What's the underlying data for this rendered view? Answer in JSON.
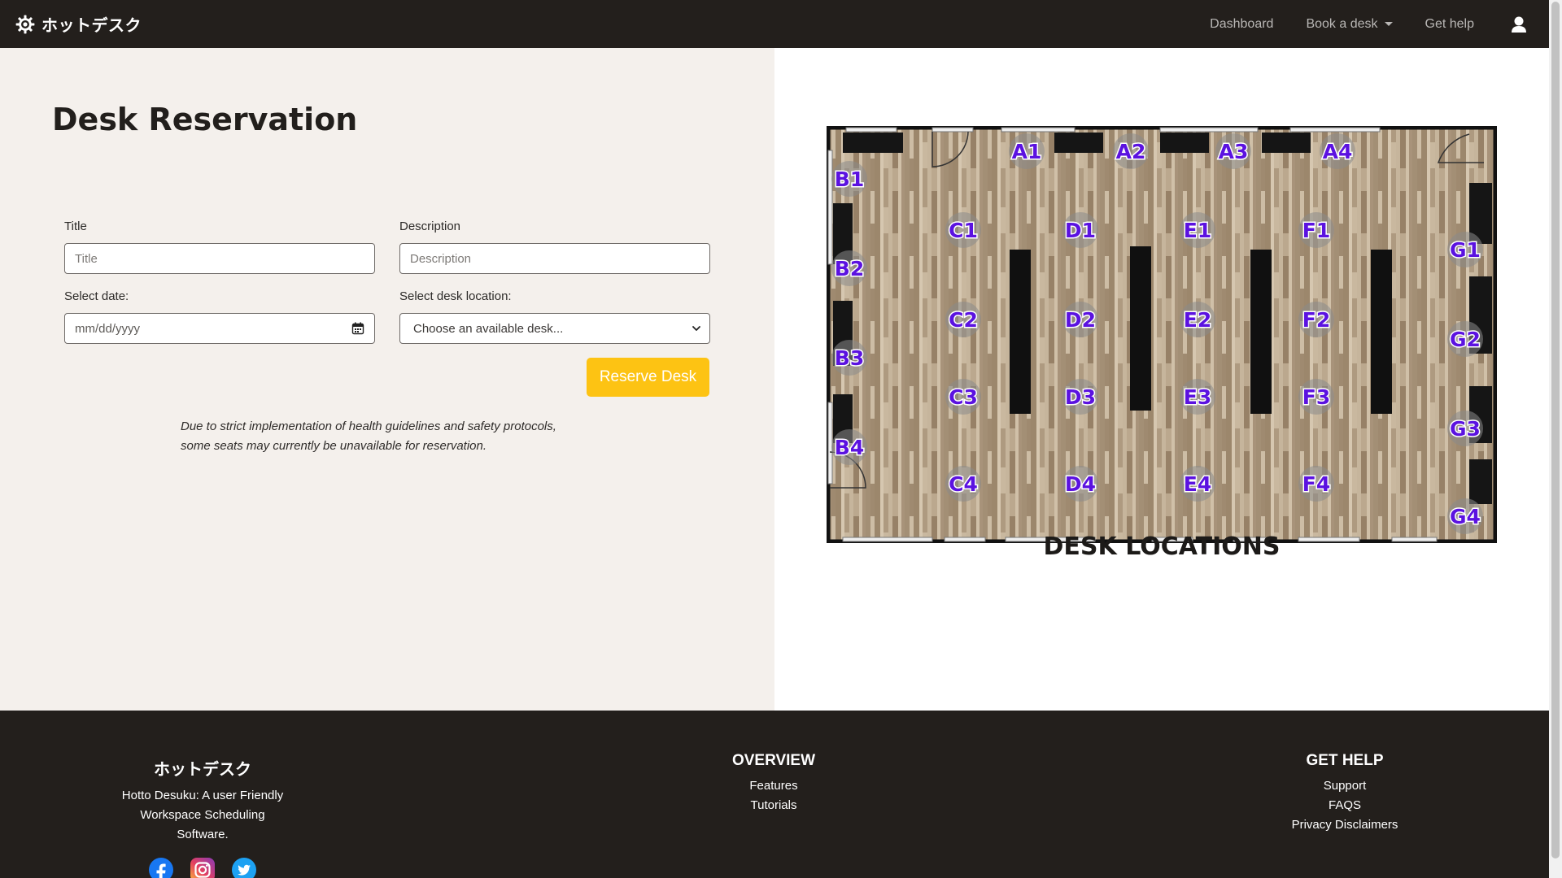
{
  "navbar": {
    "brand": "ホットデスク",
    "dashboard": "Dashboard",
    "book_desk": "Book a desk",
    "get_help": "Get help"
  },
  "form": {
    "heading": "Desk Reservation",
    "title_label": "Title",
    "title_placeholder": "Title",
    "description_label": "Description",
    "description_placeholder": "Description",
    "date_label": "Select date:",
    "date_placeholder": "mm/dd/yyyy",
    "desk_label": "Select desk location:",
    "desk_selected": "Choose an available desk...",
    "submit_label": "Reserve Desk",
    "notice_line1": "Due to strict implementation of health guidelines and safety protocols,",
    "notice_line2": "some seats may currently be unavailable for reservation."
  },
  "map": {
    "caption": "DESK LOCATIONS",
    "desks": [
      "A1",
      "A2",
      "A3",
      "A4",
      "B1",
      "B2",
      "B3",
      "B4",
      "C1",
      "C2",
      "C3",
      "C4",
      "D1",
      "D2",
      "D3",
      "D4",
      "E1",
      "E2",
      "E3",
      "E4",
      "F1",
      "F2",
      "F3",
      "F4",
      "G1",
      "G2",
      "G3",
      "G4"
    ]
  },
  "footer": {
    "brand": "ホットデスク",
    "tagline_line1": "Hotto Desuku: A user Friendly",
    "tagline_line2": "Workspace Scheduling",
    "tagline_line3": "Software.",
    "overview_heading": "OVERVIEW",
    "overview_links": [
      "Features",
      "Tutorials"
    ],
    "help_heading": "GET HELP",
    "help_links": [
      "Support",
      "FAQS",
      "Privacy Disclaimers"
    ]
  },
  "colors": {
    "navbar_bg": "#231f1c",
    "left_pane_bg": "#f4f0ec",
    "accent_button": "#fdc313",
    "desk_label": "#5b12e0"
  },
  "icons": {
    "brand": "gear-icon",
    "user": "user-icon",
    "calendar": "calendar-icon",
    "facebook": "facebook-icon",
    "instagram": "instagram-icon",
    "twitter": "twitter-icon"
  }
}
